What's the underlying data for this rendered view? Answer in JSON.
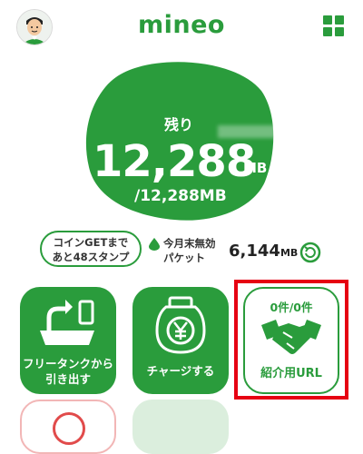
{
  "header": {
    "brand": "mineo",
    "avatar_icon": "user-avatar-icon",
    "menu_icon": "grid-menu-icon"
  },
  "data_usage": {
    "remaining_label": "残り",
    "remaining_value": "12,288",
    "remaining_unit": "MB",
    "total": "/12,288MB"
  },
  "coin": {
    "line1": "コインGETまで",
    "line2": "あと48スタンプ"
  },
  "packet": {
    "line1": "今月末無効",
    "line2": "パケット",
    "value": "6,144",
    "unit": "MB"
  },
  "tiles": [
    {
      "label_line1": "フリータンクから",
      "label_line2": "引き出す",
      "icon": "tank-withdraw-icon"
    },
    {
      "label": "チャージする",
      "icon": "yen-charge-icon"
    },
    {
      "count": "0件/0件",
      "label": "紹介用URL",
      "icon": "handshake-icon"
    }
  ],
  "colors": {
    "brand_green": "#2a9c3c",
    "highlight_red": "#e60012"
  }
}
